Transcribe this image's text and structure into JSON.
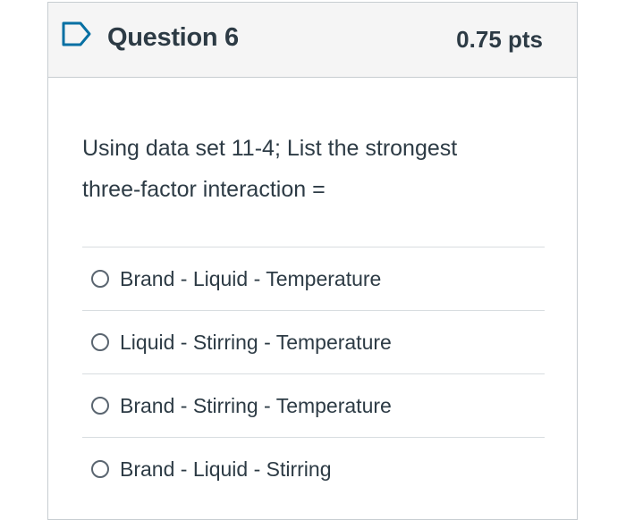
{
  "question": {
    "title": "Question 6",
    "points": "0.75 pts",
    "flag_icon": "flag-question-icon",
    "accent_color": "#0770a3",
    "text_line_1": "Using data set 11-4; List the strongest",
    "text_line_2": "three-factor interaction ="
  },
  "answers": [
    {
      "label": "Brand - Liquid - Temperature",
      "selected": false
    },
    {
      "label": "Liquid - Stirring - Temperature",
      "selected": false
    },
    {
      "label": "Brand - Stirring - Temperature",
      "selected": false
    },
    {
      "label": "Brand - Liquid - Stirring",
      "selected": false
    }
  ]
}
